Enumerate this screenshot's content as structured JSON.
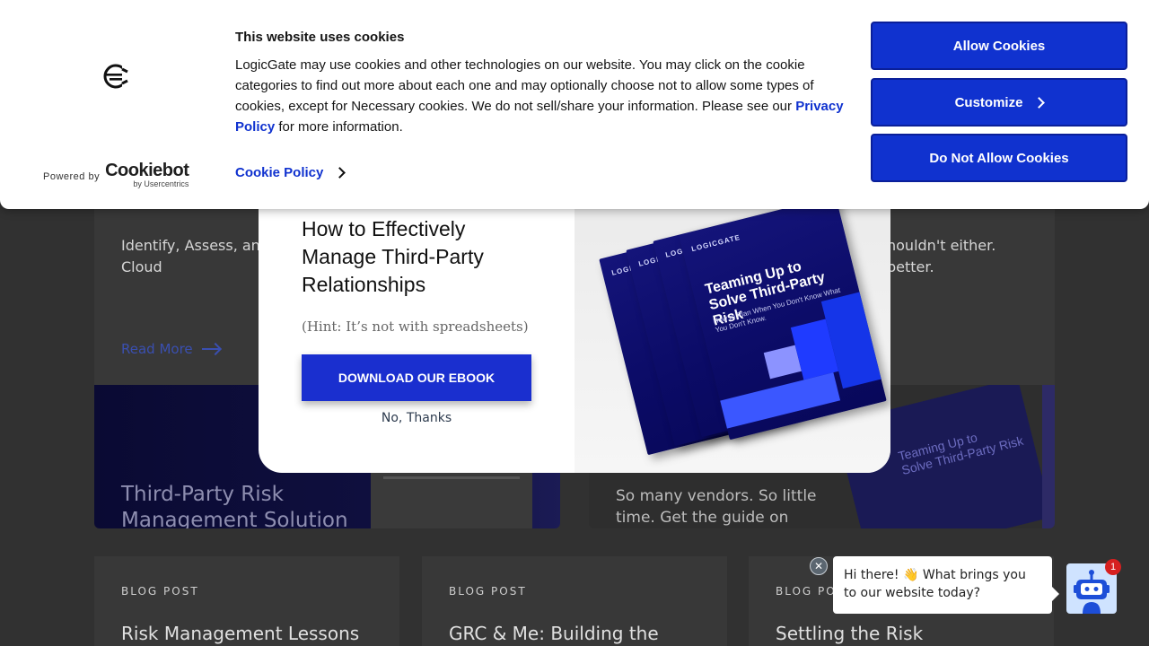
{
  "background": {
    "card_text_left": "Identify, Assess, and\nCloud",
    "card_text_right": "houldn't either.\nbetter.",
    "read_more": "Read More",
    "banner1_title": "Third-Party Risk\nManagement Solution",
    "banner2_text": "So many vendors. So little time. Get the guide on",
    "banner2_book_title": "Teaming Up to\nSolve Third-Party Risk",
    "blog_posts": [
      {
        "tag": "BLOG POST",
        "title": "Risk Management Lessons"
      },
      {
        "tag": "BLOG POST",
        "title": "GRC & Me: Building the"
      },
      {
        "tag": "BLOG POST",
        "title": "Settling the Risk"
      }
    ]
  },
  "modal": {
    "title": "How to Effectively Manage Third-Party Relationships",
    "hint": "(Hint: It’s not with spreadsheets)",
    "download_label": "DOWNLOAD OUR EBOOK",
    "no_thanks_label": "No, Thanks",
    "ebook_logo": "LOGICGATE",
    "ebook_title": "Teaming Up to Solve Third-Party Risk",
    "ebook_subtitle": "How to Plan When You Don't Know What You Don't Know."
  },
  "cookie": {
    "title": "This website uses cookies",
    "body_before": "LogicGate may use cookies and other technologies on our website. You may click on the cookie categories to find out more about each one and may optionally choose not to allow some types of cookies, except for Necessary cookies.  We do not sell/share your information. Please see our ",
    "privacy_link": "Privacy Policy",
    "body_after": " for more information.",
    "policy_link": "Cookie Policy",
    "powered_by": "Powered by",
    "cookiebot_name": "Cookiebot",
    "cookiebot_by": "by Usercentrics",
    "allow_label": "Allow Cookies",
    "customize_label": "Customize",
    "deny_label": "Do Not Allow Cookies",
    "accent_color": "#1032cf"
  },
  "chat": {
    "close_glyph": "✕",
    "message": "Hi there! 👋 What brings you to our website today?",
    "badge_count": "1"
  }
}
